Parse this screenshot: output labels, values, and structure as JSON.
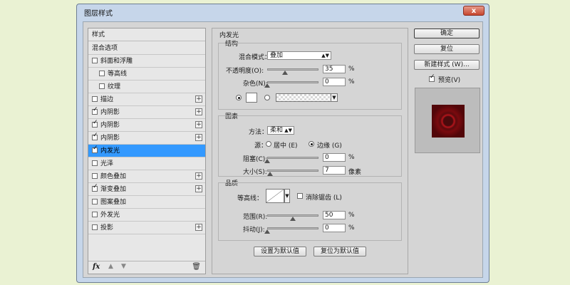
{
  "window": {
    "title": "图层样式",
    "close_label": "x"
  },
  "styles_panel": {
    "header": "样式",
    "items": [
      {
        "label": "混合选项",
        "checkbox": false,
        "checked": false,
        "plus": false,
        "indent": 0
      },
      {
        "label": "斜面和浮雕",
        "checkbox": true,
        "checked": false,
        "plus": false,
        "indent": 0
      },
      {
        "label": "等高线",
        "checkbox": true,
        "checked": false,
        "plus": false,
        "indent": 1
      },
      {
        "label": "纹理",
        "checkbox": true,
        "checked": false,
        "plus": false,
        "indent": 1
      },
      {
        "label": "描边",
        "checkbox": true,
        "checked": false,
        "plus": true,
        "indent": 0
      },
      {
        "label": "内阴影",
        "checkbox": true,
        "checked": true,
        "plus": true,
        "indent": 0
      },
      {
        "label": "内阴影",
        "checkbox": true,
        "checked": true,
        "plus": true,
        "indent": 0
      },
      {
        "label": "内阴影",
        "checkbox": true,
        "checked": true,
        "plus": true,
        "indent": 0
      },
      {
        "label": "内发光",
        "checkbox": true,
        "checked": true,
        "plus": false,
        "indent": 0,
        "selected": true
      },
      {
        "label": "光泽",
        "checkbox": true,
        "checked": false,
        "plus": false,
        "indent": 0
      },
      {
        "label": "颜色叠加",
        "checkbox": true,
        "checked": false,
        "plus": true,
        "indent": 0
      },
      {
        "label": "渐变叠加",
        "checkbox": true,
        "checked": true,
        "plus": true,
        "indent": 0
      },
      {
        "label": "图案叠加",
        "checkbox": true,
        "checked": false,
        "plus": false,
        "indent": 0
      },
      {
        "label": "外发光",
        "checkbox": true,
        "checked": false,
        "plus": false,
        "indent": 0
      },
      {
        "label": "投影",
        "checkbox": true,
        "checked": false,
        "plus": true,
        "indent": 0
      }
    ],
    "footer": {
      "fx": "fx",
      "up": "▲",
      "down": "▼",
      "trash": "🗑"
    }
  },
  "inner_glow": {
    "title": "内发光",
    "structure": {
      "title": "结构",
      "blend_mode_label": "混合模式：",
      "blend_mode_value": "叠加",
      "opacity_label": "不透明度(O):",
      "opacity_value": "35",
      "opacity_level": 35,
      "noise_label": "杂色(N):",
      "noise_value": "0",
      "noise_level": 0,
      "percent": "%"
    },
    "elements": {
      "title": "图素",
      "method_label": "方法：",
      "method_value": "柔和",
      "source_label": "源：",
      "source_center": "居中 (E)",
      "source_edge": "边缘 (G)",
      "choke_label": "阻塞(C):",
      "choke_value": "0",
      "choke_level": 0,
      "size_label": "大小(S):",
      "size_value": "7",
      "size_unit": "像素",
      "percent": "%"
    },
    "quality": {
      "title": "品质",
      "contour_label": "等高线：",
      "antialias_label": "消除锯齿 (L)",
      "range_label": "范围(R):",
      "range_value": "50",
      "range_level": 50,
      "jitter_label": "抖动(J):",
      "jitter_value": "0",
      "jitter_level": 0,
      "percent": "%"
    },
    "buttons": {
      "make_default": "设置为默认值",
      "reset_default": "复位为默认值"
    }
  },
  "actions": {
    "ok": "确定",
    "reset": "复位",
    "new_style": "新建样式 (W)...",
    "preview_label": "预览(V)",
    "preview_checked": true
  },
  "colors": {
    "selection": "#3399ff",
    "preview_red": "#b6141b",
    "page_bg": "#eaf2d3"
  }
}
